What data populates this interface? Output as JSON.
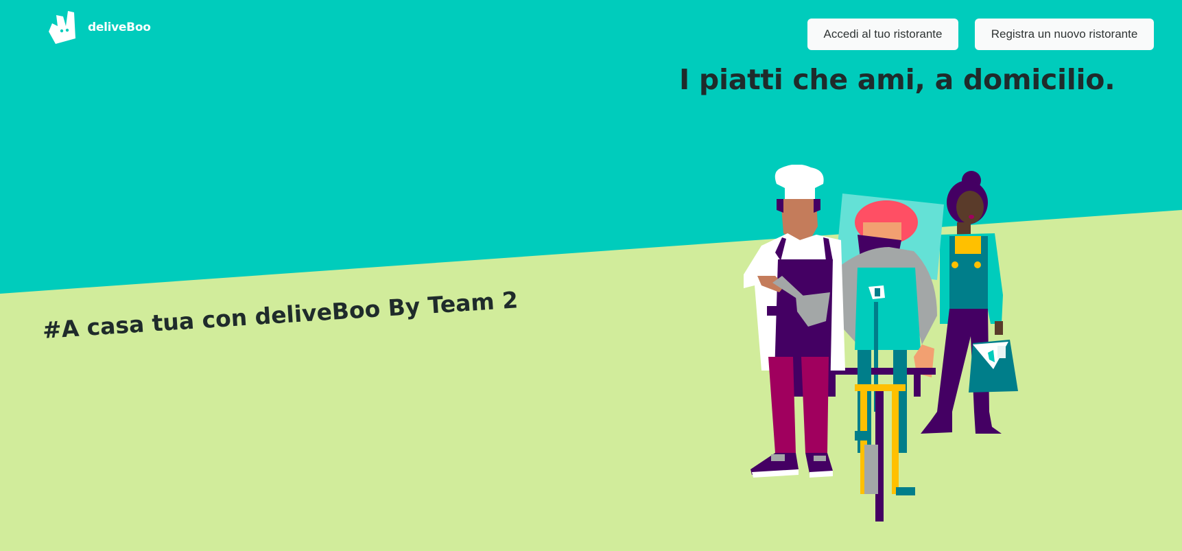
{
  "header": {
    "brand": "deliveBoo",
    "logo_icon": "kangaroo-logo-icon",
    "login_label": "Accedi al tuo ristorante",
    "register_label": "Registra un nuovo ristorante"
  },
  "hero": {
    "headline": "I piatti che ami, a domicilio.",
    "tagline": "#A casa tua con deliveBoo By Team 2",
    "illustration": "chef-rider-customer-illustration"
  },
  "colors": {
    "top_background": "#00ccbc",
    "bottom_background": "#d1ec9b",
    "text_dark": "#1f2b2b",
    "button_bg": "#f9fafa"
  }
}
